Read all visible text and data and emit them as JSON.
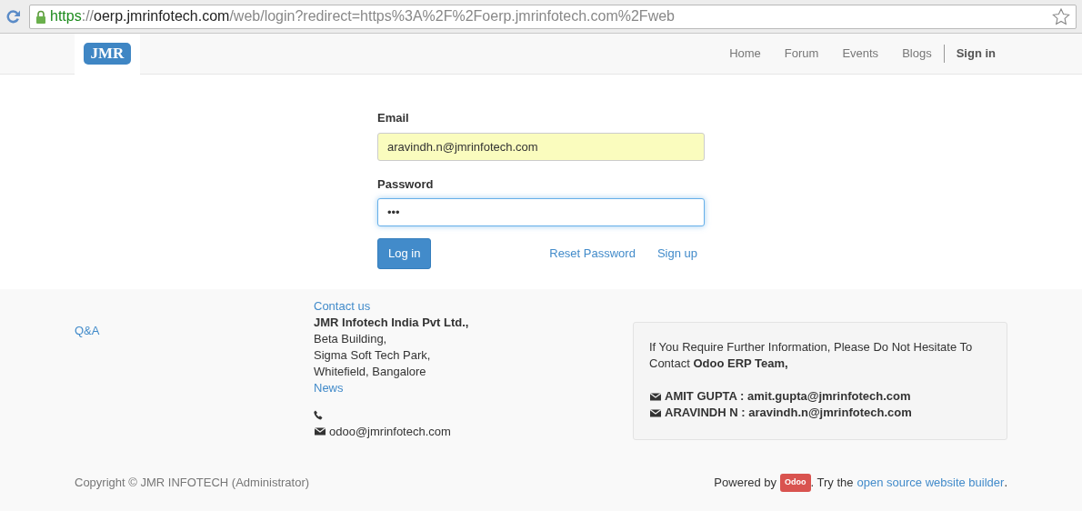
{
  "browser": {
    "secure": true,
    "url_parts": [
      {
        "text": "https",
        "kind": "scheme"
      },
      {
        "text": "://",
        "kind": "plain"
      },
      {
        "text": "oerp.jmrinfotech.com",
        "kind": "host"
      },
      {
        "text": "/web/login?redirect=https%3A%2F%2Foerp.jmrinfotech.com%2Fweb",
        "kind": "plain"
      }
    ]
  },
  "navbar": {
    "logo_text": "JMR",
    "links": [
      {
        "label": "Home",
        "selected": false
      },
      {
        "label": "Forum",
        "selected": false
      },
      {
        "label": "Events",
        "selected": false
      },
      {
        "label": "Blogs",
        "selected": false
      }
    ],
    "sign_in": "Sign in"
  },
  "login": {
    "email": {
      "label": "Email",
      "value": "aravindh.n@jmrinfotech.com",
      "autofilled": true
    },
    "password": {
      "label": "Password",
      "value": "•••",
      "focused": true
    },
    "submit": "Log in",
    "links": [
      "Reset Password",
      "Sign up"
    ]
  },
  "footer": {
    "left_links": [
      "Q&A"
    ],
    "contact": {
      "heading": "Contact us",
      "company": "JMR Infotech India Pvt Ltd.,",
      "address": [
        "Beta Building,",
        "Sigma Soft Tech Park,",
        "Whitefield, Bangalore"
      ],
      "news": "News",
      "email": "odoo@jmrinfotech.com"
    },
    "info_box": {
      "text": "If You Require Further Information, Please Do Not Hesitate To Contact **Odoo ERP Team,**",
      "contacts": [
        "AMIT GUPTA : amit.gupta@jmrinfotech.com",
        "ARAVINDH N : aravindh.n@jmrinfotech.com"
      ]
    },
    "copyright": "Copyright © JMR INFOTECH (Administrator)",
    "powered_by": {
      "prefix": "Powered by",
      "badge": "Odoo",
      "middle": ". Try the",
      "link": "open source website builder",
      "suffix": "."
    }
  }
}
